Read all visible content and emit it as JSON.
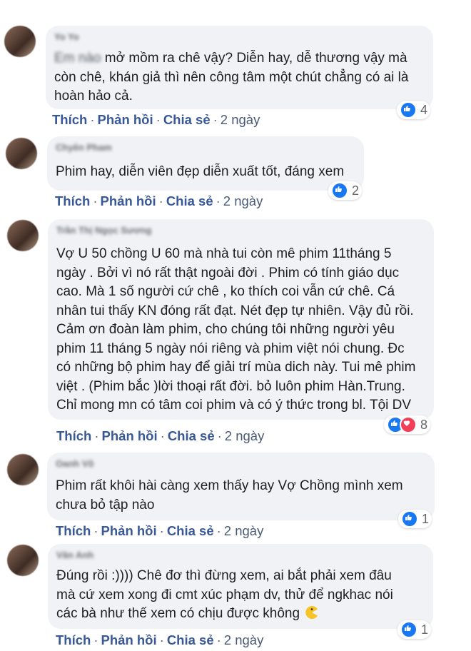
{
  "comments": [
    {
      "name": "Yo Yo",
      "text_prefix": "Em nào",
      "text": "mở mồm ra chê vậy? Diễn hay, dễ thương vậy mà còn chê, khán giả thì nên công tâm một chút chẳng có ai là hoàn hảo cả.",
      "like_label": "Thích",
      "reply_label": "Phản hồi",
      "share_label": "Chia sẻ",
      "time": "2 ngày",
      "reactions": [
        "like"
      ],
      "reaction_count": "4"
    },
    {
      "name": "Chyên Pham",
      "text": "Phim hay, diễn viên đẹp diễn xuất tốt, đáng xem",
      "like_label": "Thích",
      "reply_label": "Phản hồi",
      "share_label": "Chia sẻ",
      "time": "2 ngày",
      "reactions": [
        "like"
      ],
      "reaction_count": "2"
    },
    {
      "name": "Trần Thị Ngọc Sương",
      "text": "Vợ U 50 chồng U 60 mà nhà tui còn mê phim 11tháng 5 ngày . Bởi vì nó rất thật ngoài đời . Phim có tính giáo dục cao. Mà 1 số người cứ chê , ko thích coi vẫn cứ chê. Cá nhân tui thấy KN đóng rất đạt. Nét đẹp tự nhiên. Vậy đủ rồi. Cảm ơn đoàn làm phim, cho chúng tôi những người yêu phim 11 tháng 5 ngày nói riêng và phim việt nói chung. Đc có những bộ phim hay để giải trí mùa dich này. Tui mê phim việt . (Phim bắc )lời thoại rất đời. bỏ luôn phim Hàn.Trung. Chỉ mong mn có tâm coi phim và có ý thức trong bl. Tội DV",
      "like_label": "Thích",
      "reply_label": "Phản hồi",
      "share_label": "Chia sẻ",
      "time": "2 ngày",
      "reactions": [
        "like",
        "heart"
      ],
      "reaction_count": "8"
    },
    {
      "name": "Oanh Võ",
      "text": "Phim rất khôi hài càng xem thấy hay Vợ Chồng mình xem chưa bỏ tập nào",
      "like_label": "Thích",
      "reply_label": "Phản hồi",
      "share_label": "Chia sẻ",
      "time": "2 ngày",
      "reactions": [
        "like"
      ],
      "reaction_count": "1"
    },
    {
      "name": "Văn Anh",
      "text": "Đúng rồi :)))) Chê đơ thì đừng xem, ai bắt phải xem đâu mà cứ xem xong đi cmt xúc phạm dv, thử để ngkhac nói các bà như thế xem có chịu được không",
      "emoji": "pacman-emoji",
      "like_label": "Thích",
      "reply_label": "Phản hồi",
      "share_label": "Chia sẻ",
      "time": "2 ngày",
      "reactions": [
        "like"
      ],
      "reaction_count": "1"
    }
  ],
  "colors": {
    "bubble": "#f0f2f5",
    "link": "#385898",
    "like": "#1877f2",
    "heart": "#f33e58"
  }
}
